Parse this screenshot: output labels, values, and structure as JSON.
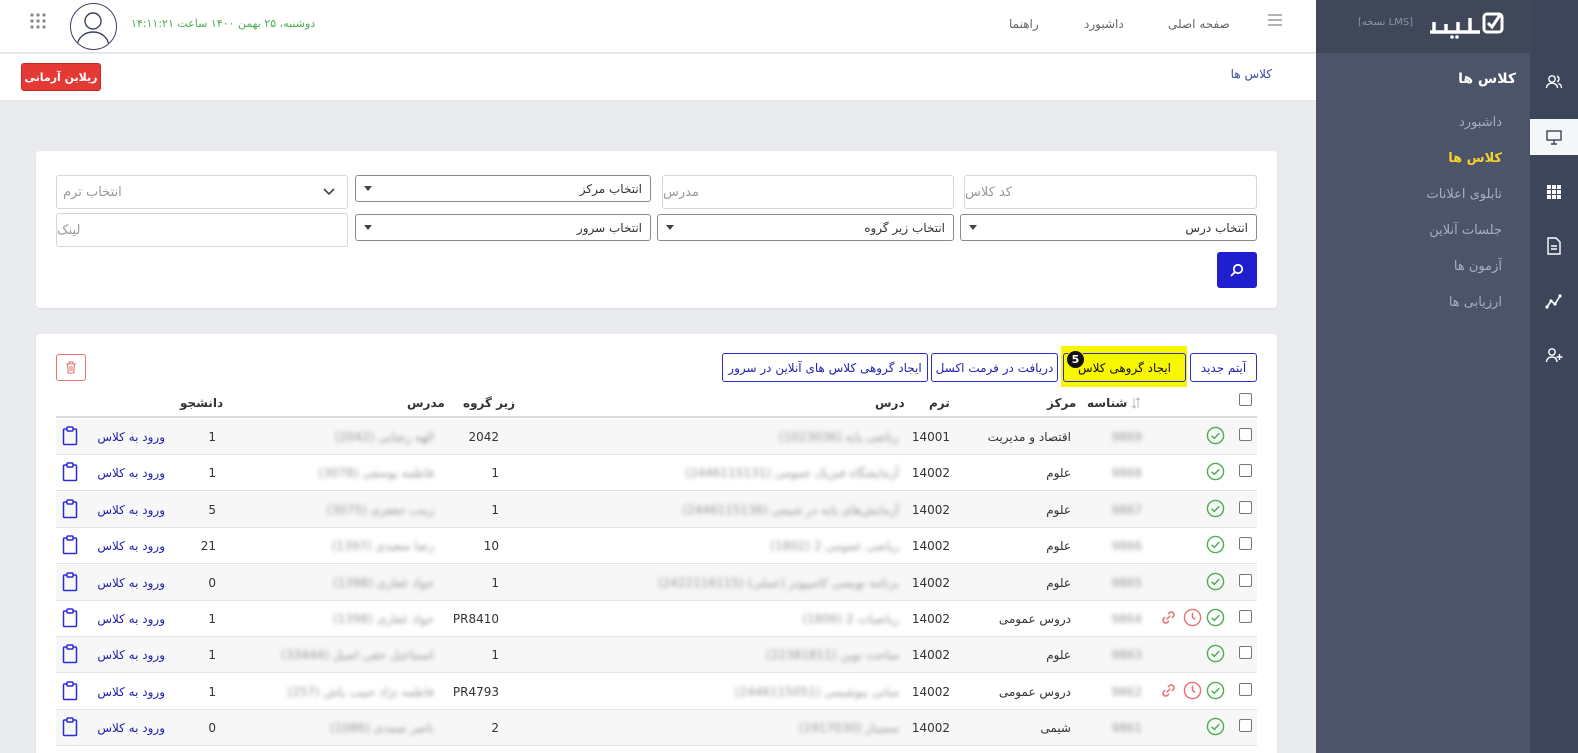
{
  "sidebar": {
    "lms_tag": "[نسخه LMS]",
    "section_title": "کلاس ها",
    "items": [
      {
        "label": "داشبورد",
        "active": false
      },
      {
        "label": "کلاس ها",
        "active": true
      },
      {
        "label": "تابلوی اعلانات",
        "active": false
      },
      {
        "label": "جلسات آنلاین",
        "active": false
      },
      {
        "label": "آزمون ها",
        "active": false
      },
      {
        "label": "ارزیابی ها",
        "active": false
      }
    ]
  },
  "rail_icons": [
    "users-icon",
    "monitor-icon",
    "grid-icon",
    "document-icon",
    "analytics-icon",
    "add-user-icon"
  ],
  "topbar": {
    "nav": [
      "صفحه اصلی",
      "داشبورد",
      "راهنما"
    ],
    "datetime": "دوشنبه، ۲۵ بهمن ۱۴۰۰ ساعت ۱۴:۱۱:۲۱"
  },
  "breadcrumb": "کلاس ها",
  "org_button": "ریلاین آرمانی",
  "filters": {
    "class_code_placeholder": "کد کلاس",
    "teacher_placeholder": "مدرس",
    "center_select": "انتخاب مرکز",
    "term_select": "انتخاب ترم",
    "course_select": "انتخاب درس",
    "subgroup_select": "انتخاب زیر گروه",
    "server_select": "انتخاب سرور",
    "link_placeholder": "لینک"
  },
  "toolbar": {
    "new_item": "آیتم جدید",
    "bulk_create": "ایجاد گروهی کلاس",
    "excel": "دریافت در فرمت اکسل",
    "bulk_online": "ایجاد گروهی کلاس های آنلاین در سرور",
    "step_badge": "5"
  },
  "table": {
    "headers": {
      "id": "شناسه",
      "center": "مرکز",
      "term": "ترم",
      "course": "درس",
      "subgroup": "زیر گروه",
      "teacher": "مدرس",
      "students": "دانشجو"
    },
    "enter_label": "ورود به کلاس",
    "rows": [
      {
        "id": "9869",
        "center": "اقتصاد و مدیریت",
        "term": "14001",
        "course": "ریاضی پایه (1023036)",
        "subgroup": "2042",
        "teacher": "الهه رضایی (2042)",
        "students": "1",
        "extra_icons": false
      },
      {
        "id": "9868",
        "center": "علوم",
        "term": "14002",
        "course": "آزمایشگاه فیزیک عمومی (2446115131)",
        "subgroup": "1",
        "teacher": "فاطمه یوسفی (3078)",
        "students": "1",
        "extra_icons": false
      },
      {
        "id": "9867",
        "center": "علوم",
        "term": "14002",
        "course": "آزمایش‌های پایه در شیمی (2446115136)",
        "subgroup": "1",
        "teacher": "زینب جعفری (3075)",
        "students": "5",
        "extra_icons": false
      },
      {
        "id": "9866",
        "center": "علوم",
        "term": "14002",
        "course": "ریاضی عمومی 2 (1802)",
        "subgroup": "10",
        "teacher": "رضا سعیدی (1397)",
        "students": "21",
        "extra_icons": false
      },
      {
        "id": "9865",
        "center": "علوم",
        "term": "14002",
        "course": "برنامه نویسی کامپیوتر (عملی) (2422116115)",
        "subgroup": "1",
        "teacher": "جواد غفاری (1398)",
        "students": "0",
        "extra_icons": false
      },
      {
        "id": "9864",
        "center": "دروس عمومی",
        "term": "14002",
        "course": "ریاضیات 2 (1806)",
        "subgroup": "PR8410",
        "teacher": "جواد غفاری (1398)",
        "students": "1",
        "extra_icons": true
      },
      {
        "id": "9863",
        "center": "علوم",
        "term": "14002",
        "course": "مباحث نوین (22381811)",
        "subgroup": "1",
        "teacher": "اسماعیل حقی اصیل (33444)",
        "students": "1",
        "extra_icons": false
      },
      {
        "id": "9862",
        "center": "دروس عمومی",
        "term": "14002",
        "course": "مبانی بیوشیمی (2446115051)",
        "subgroup": "PR4793",
        "teacher": "فاطمه نژاد حبیب پاش (257)",
        "students": "1",
        "extra_icons": true
      },
      {
        "id": "9861",
        "center": "شیمی",
        "term": "14002",
        "course": "سمینار (1917030)",
        "subgroup": "2",
        "teacher": "ناصر صمدی (1086)",
        "students": "0",
        "extra_icons": false
      }
    ]
  },
  "colors": {
    "sidebar_bg": "#4b5468",
    "rail_bg": "#3c4559",
    "accent_yellow": "#f7d12d",
    "primary_blue": "#1f1fd0",
    "danger_red": "#e53935",
    "ok_green": "#4caf50",
    "date_green": "#4caf50"
  }
}
